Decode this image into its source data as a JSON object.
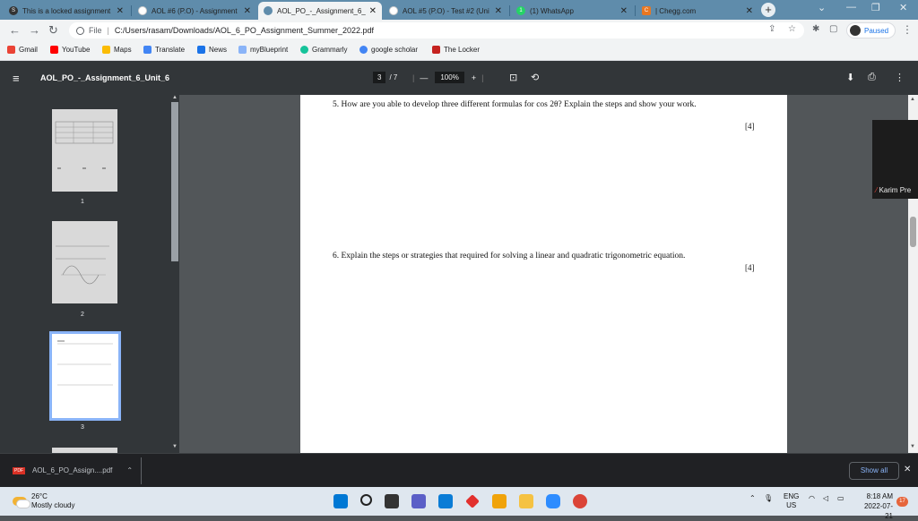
{
  "tabs": [
    {
      "title": "This is a locked assignment",
      "favicon": "s-icon",
      "color": "#333333"
    },
    {
      "title": "AOL #6 (P.O) - Assignment",
      "favicon": "globe-icon",
      "color": "#5f8cab"
    },
    {
      "title": "AOL_PO_-_Assignment_6_U",
      "favicon": "globe-icon",
      "color": "#5f8cab"
    },
    {
      "title": "AOL #5 (P.O) - Test #2 (Uni",
      "favicon": "globe-icon",
      "color": "#5f8cab"
    },
    {
      "title": "(1) WhatsApp",
      "favicon": "whatsapp-icon",
      "color": "#25d366"
    },
    {
      "title": "| Chegg.com",
      "favicon": "chegg-icon",
      "color": "#e87722"
    }
  ],
  "address": {
    "scheme": "File",
    "url": "C:/Users/rasam/Downloads/AOL_6_PO_Assignment_Summer_2022.pdf"
  },
  "profile": {
    "label": "Paused"
  },
  "bookmarks": [
    "Gmail",
    "YouTube",
    "Maps",
    "Translate",
    "News",
    "myBlueprint",
    "Grammarly",
    "google scholar",
    "The Locker"
  ],
  "pdf": {
    "title": "AOL_PO_-_Assignment_6_Unit_6",
    "current_page": "3",
    "total_pages": "/ 7",
    "zoom": "100%",
    "thumbnails": [
      "1",
      "2",
      "3"
    ]
  },
  "page": {
    "q5_text": "5. How are you able to develop three different formulas for cos 2θ? Explain the steps and show your work.",
    "q5_mark": "[4]",
    "q6_text": "6. Explain the steps or strategies that required for solving a linear and quadratic trigonometric equation.",
    "q6_mark": "[4]"
  },
  "overlay": {
    "label": "Karim Pre"
  },
  "download": {
    "filename": "AOL_6_PO_Assign....pdf",
    "show_all": "Show all"
  },
  "taskbar": {
    "temperature": "26°C",
    "weather": "Mostly cloudy",
    "lang1": "ENG",
    "lang2": "US",
    "time": "8:18 AM",
    "date": "2022-07-21",
    "notifications": "17"
  }
}
